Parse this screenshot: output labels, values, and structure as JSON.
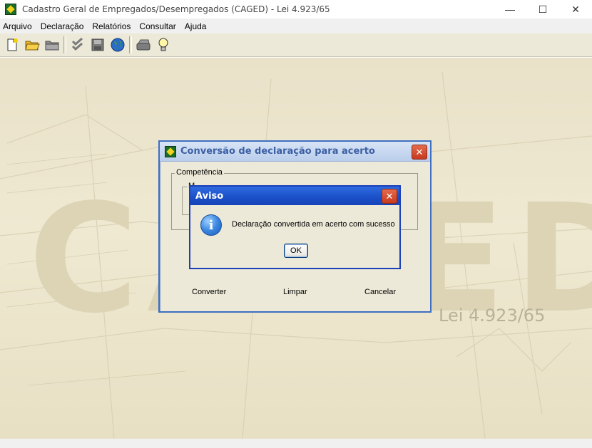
{
  "window": {
    "title": "Cadastro Geral de Empregados/Desempregados (CAGED) - Lei 4.923/65",
    "controls": {
      "minimize": "—",
      "maximize": "☐",
      "close": "✕"
    }
  },
  "menubar": {
    "items": [
      {
        "label": "Arquivo"
      },
      {
        "label": "Declaração"
      },
      {
        "label": "Relatórios"
      },
      {
        "label": "Consultar"
      },
      {
        "label": "Ajuda"
      }
    ]
  },
  "toolbar": {
    "buttons": [
      {
        "icon": "new-file-icon"
      },
      {
        "icon": "open-folder-icon"
      },
      {
        "icon": "folder-icon"
      },
      {
        "icon": "check-icon"
      },
      {
        "icon": "save-icon"
      },
      {
        "icon": "globe-icon"
      },
      {
        "icon": "print-icon"
      },
      {
        "icon": "lightbulb-icon"
      }
    ]
  },
  "background": {
    "watermark": "CAGED",
    "law_text": "Lei 4.923/65"
  },
  "dialog": {
    "title": "Conversão de declaração para acerto",
    "group_label": "Competência",
    "inner_group_label": "M",
    "actions": {
      "convert": "Converter",
      "clear": "Limpar",
      "cancel": "Cancelar"
    }
  },
  "aviso": {
    "title": "Aviso",
    "message": "Declaração convertida em acerto com sucesso",
    "ok": "OK"
  },
  "colors": {
    "dialog_border": "#3e6fc2",
    "aviso_title": "#1a4fc7",
    "close_button": "#c63a1e",
    "desktop_bg": "#ebe4cb"
  }
}
